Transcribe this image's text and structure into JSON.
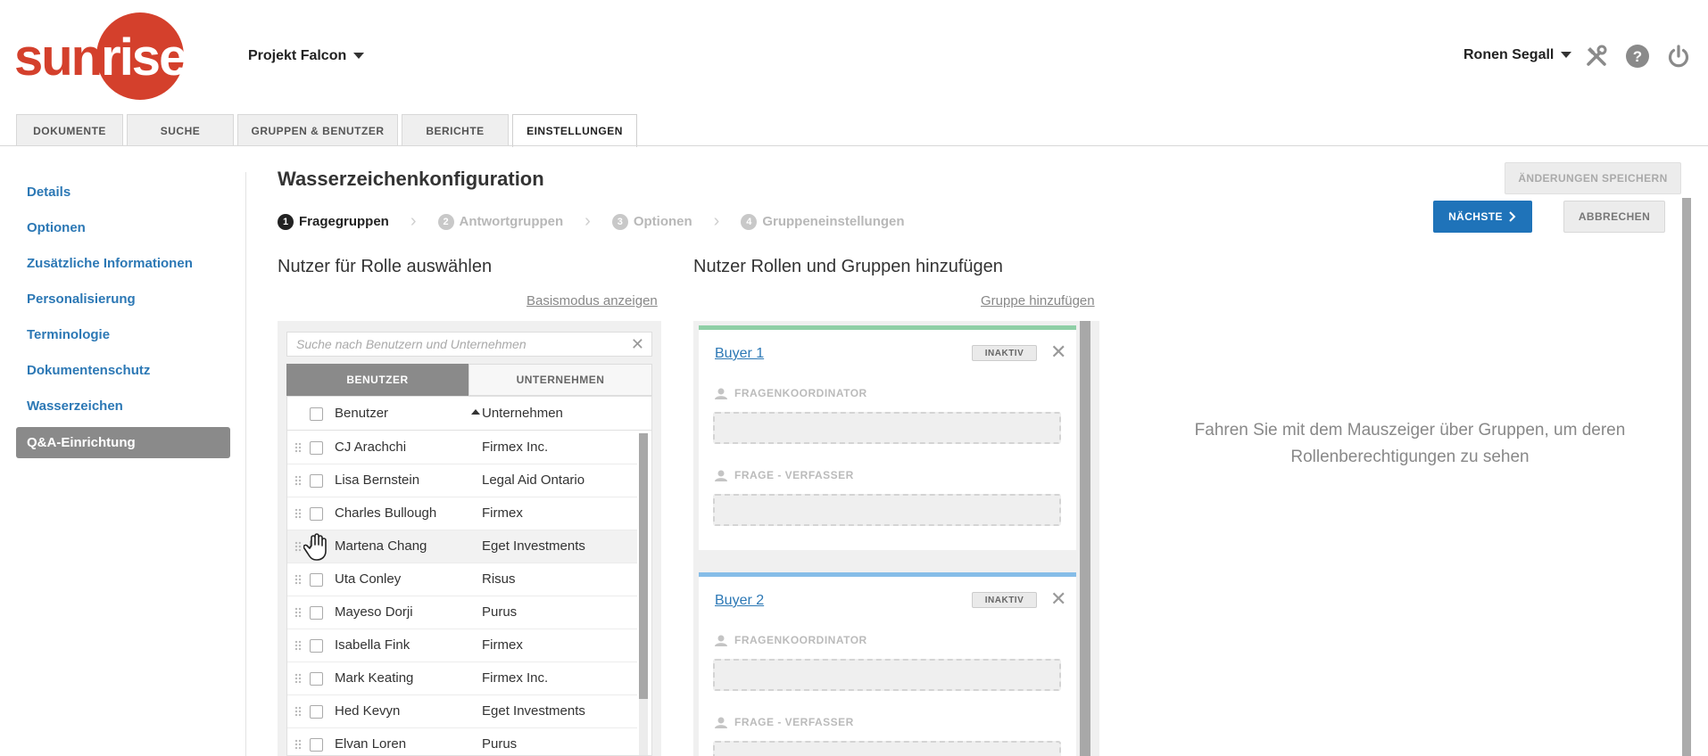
{
  "brand": {
    "logo_text_a": "sun",
    "logo_text_b": "rise",
    "accent": "#d4402c"
  },
  "header": {
    "project": "Projekt Falcon",
    "user": "Ronen Segall",
    "icons": [
      "tools-icon",
      "help-icon",
      "power-icon"
    ]
  },
  "tabs": [
    "DOKUMENTE",
    "SUCHE",
    "GRUPPEN & BENUTZER",
    "BERICHTE",
    "EINSTELLUNGEN"
  ],
  "active_tab": "EINSTELLUNGEN",
  "sidebar": {
    "items": [
      {
        "label": "Details"
      },
      {
        "label": "Optionen"
      },
      {
        "label": "Zusätzliche Informationen"
      },
      {
        "label": "Personalisierung"
      },
      {
        "label": "Terminologie"
      },
      {
        "label": "Dokumentenschutz"
      },
      {
        "label": "Wasserzeichen"
      },
      {
        "label": "Q&A-Einrichtung"
      }
    ]
  },
  "main": {
    "title": "Wasserzeichenkonfiguration",
    "steps": [
      {
        "num": "1",
        "label": "Fragegruppen"
      },
      {
        "num": "2",
        "label": "Antwortgruppen"
      },
      {
        "num": "3",
        "label": "Optionen"
      },
      {
        "num": "4",
        "label": "Gruppeneinstellungen"
      }
    ],
    "buttons": {
      "save": "ÄNDERUNGEN SPEICHERN",
      "next": "NÄCHSTE",
      "cancel": "ABBRECHEN"
    },
    "left": {
      "title": "Nutzer für Rolle auswählen",
      "link": "Basismodus anzeigen",
      "search_placeholder": "Suche nach Benutzern und Unternehmen",
      "subtabs": [
        "BENUTZER",
        "UNTERNEHMEN"
      ],
      "columns": [
        "Benutzer",
        "Unternehmen"
      ],
      "rows": [
        {
          "user": "CJ Arachchi",
          "company": "Firmex Inc."
        },
        {
          "user": "Lisa Bernstein",
          "company": "Legal Aid Ontario"
        },
        {
          "user": "Charles Bullough",
          "company": "Firmex"
        },
        {
          "user": "Martena Chang",
          "company": "Eget Investments"
        },
        {
          "user": "Uta Conley",
          "company": "Risus"
        },
        {
          "user": "Mayeso Dorji",
          "company": "Purus"
        },
        {
          "user": "Isabella Fink",
          "company": "Firmex"
        },
        {
          "user": "Mark Keating",
          "company": "Firmex Inc."
        },
        {
          "user": "Hed Kevyn",
          "company": "Eget Investments"
        },
        {
          "user": "Elvan Loren",
          "company": "Purus"
        }
      ]
    },
    "middle": {
      "title": "Nutzer Rollen und Gruppen hinzufügen",
      "link": "Gruppe hinzufügen",
      "groups": [
        {
          "name": "Buyer 1",
          "status": "INAKTIV",
          "roles": [
            "FRAGENKOORDINATOR",
            "FRAGE - VERFASSER"
          ]
        },
        {
          "name": "Buyer 2",
          "status": "INAKTIV",
          "roles": [
            "FRAGENKOORDINATOR",
            "FRAGE - VERFASSER"
          ]
        }
      ]
    },
    "hint": "Fahren Sie mit dem Mauszeiger über Gruppen, um deren Rollenberechtigungen zu sehen"
  }
}
